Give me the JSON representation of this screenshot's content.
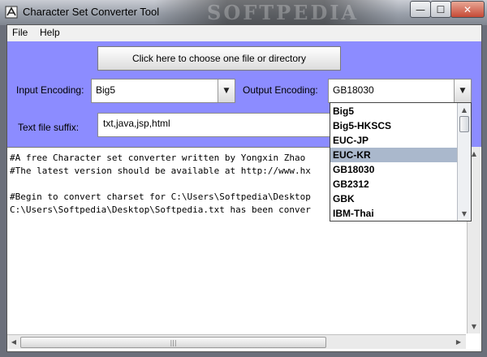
{
  "window": {
    "title": "Character Set Converter Tool",
    "watermark": "SOFTPEDIA"
  },
  "window_controls": {
    "minimize": "—",
    "maximize": "☐",
    "close": "✕"
  },
  "menu": [
    {
      "label": "File"
    },
    {
      "label": "Help"
    }
  ],
  "choose_button": {
    "label": "Click here to choose one file or directory"
  },
  "input_encoding": {
    "label": "Input Encoding:",
    "value": "Big5"
  },
  "output_encoding": {
    "label": "Output Encoding:",
    "value": "GB18030"
  },
  "suffix": {
    "label": "Text file suffix:",
    "value": "txt,java,jsp,html"
  },
  "dropdown": {
    "options": [
      "Big5",
      "Big5-HKSCS",
      "EUC-JP",
      "EUC-KR",
      "GB18030",
      "GB2312",
      "GBK",
      "IBM-Thai"
    ],
    "highlighted": "EUC-KR"
  },
  "log": [
    "#A free Character set converter written by Yongxin Zhao",
    "#The latest version should be available at http://www.hx",
    "",
    "#Begin to convert charset for C:\\Users\\Softpedia\\Desktop",
    "C:\\Users\\Softpedia\\Desktop\\Softpedia.txt has been conver"
  ],
  "colors": {
    "panel": "#8c8cff",
    "selection": "#aab8cc"
  }
}
